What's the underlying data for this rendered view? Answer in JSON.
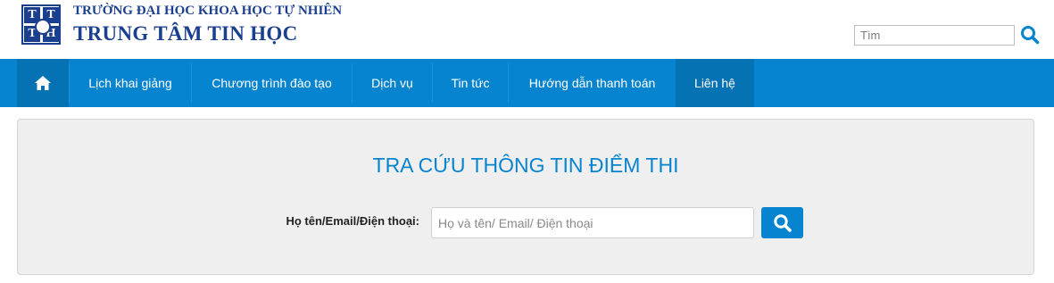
{
  "header": {
    "logo_letters": [
      "T",
      "T",
      "T",
      "H"
    ],
    "university_name": "TRƯỜNG ĐẠI HỌC KHOA HỌC TỰ NHIÊN",
    "center_name": "TRUNG TÂM TIN HỌC",
    "search_placeholder": "Tìm",
    "search_icon": "search-icon"
  },
  "nav": {
    "home_icon": "home-icon",
    "items": [
      {
        "label": "Lịch khai giảng"
      },
      {
        "label": "Chương trình đào tạo"
      },
      {
        "label": "Dịch vụ"
      },
      {
        "label": "Tin tức"
      },
      {
        "label": "Hướng dẫn thanh toán"
      },
      {
        "label": "Liên hệ",
        "active": true
      }
    ]
  },
  "lookup": {
    "title": "TRA CỨU THÔNG TIN ĐIỂM THI",
    "field_label": "Họ tên/Email/Điện thoại:",
    "field_placeholder": "Họ và tên/ Email/ Điện thoại",
    "submit_icon": "search-icon"
  },
  "colors": {
    "brand": "#1b3f8f",
    "nav_bg": "#0784cf",
    "nav_active": "#0572b4",
    "panel_bg": "#efefef"
  }
}
